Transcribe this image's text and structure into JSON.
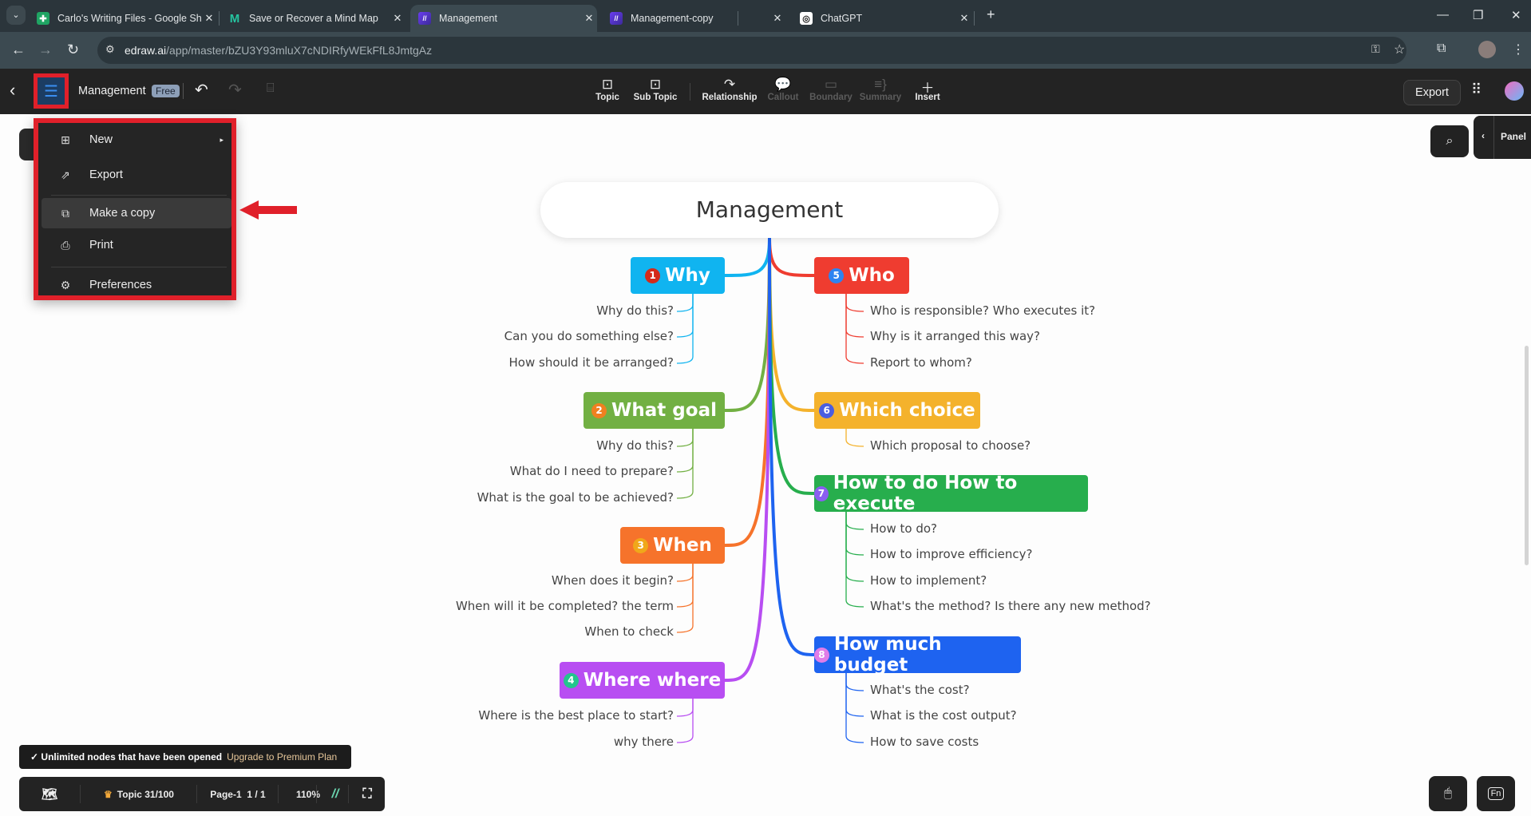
{
  "browser": {
    "tabs": [
      {
        "title": "Carlo's Writing Files - Google Sh",
        "icon": "google-sheets-icon",
        "active": false
      },
      {
        "title": "Save or Recover a Mind Map",
        "icon": "mindmap-site-icon",
        "active": false
      },
      {
        "title": "Management",
        "icon": "edraw-icon",
        "active": true
      },
      {
        "title": "Management-copy",
        "icon": "edraw-icon",
        "active": false
      },
      {
        "title": "ChatGPT",
        "icon": "chatgpt-icon",
        "active": false
      }
    ],
    "url_host": "edraw.ai",
    "url_path": "/app/master/bZU3Y93mluX7cNDIRfyWEkFfL8JmtgAz"
  },
  "app": {
    "doc_title": "Management",
    "plan_badge": "Free",
    "toolbar": [
      {
        "label": "Topic",
        "icon": "topic-icon",
        "enabled": true
      },
      {
        "label": "Sub Topic",
        "icon": "subtopic-icon",
        "enabled": true
      },
      {
        "label": "Relationship",
        "icon": "relationship-icon",
        "enabled": true
      },
      {
        "label": "Callout",
        "icon": "callout-icon",
        "enabled": false
      },
      {
        "label": "Boundary",
        "icon": "boundary-icon",
        "enabled": false
      },
      {
        "label": "Summary",
        "icon": "summary-icon",
        "enabled": false
      },
      {
        "label": "Insert",
        "icon": "plus-icon",
        "enabled": true
      }
    ],
    "export_label": "Export",
    "panel_label": "Panel"
  },
  "menu": {
    "items": [
      {
        "label": "New",
        "icon": "plus-square-icon",
        "submenu": true
      },
      {
        "label": "Export",
        "icon": "export-icon"
      },
      {
        "label": "Make a copy",
        "icon": "copy-icon",
        "highlighted": true
      },
      {
        "label": "Print",
        "icon": "printer-icon"
      },
      {
        "label": "Preferences",
        "icon": "gear-icon"
      }
    ]
  },
  "mindmap": {
    "root": "Management",
    "topics": [
      {
        "num": "1",
        "label": "Why",
        "color": "#10b4f0",
        "children": [
          "Why do this?",
          "Can you do something else?",
          "How should it be arranged?"
        ]
      },
      {
        "num": "2",
        "label": "What goal",
        "color": "#72b043",
        "children": [
          "Why do this?",
          "What do I need to prepare?",
          "What is the goal to be achieved?"
        ]
      },
      {
        "num": "3",
        "label": "When",
        "color": "#f6732b",
        "children": [
          "When does it begin?",
          "When will it be completed? the term",
          "When to check"
        ]
      },
      {
        "num": "4",
        "label": "Where where",
        "color": "#b84ef2",
        "children": [
          "Where is the best place to start?",
          "why there"
        ]
      },
      {
        "num": "5",
        "label": "Who",
        "color": "#ef3c30",
        "children": [
          "Who is responsible? Who executes it?",
          "Why is it arranged this way?",
          "Report to whom?"
        ]
      },
      {
        "num": "6",
        "label": "Which choice",
        "color": "#f4b22c",
        "children": [
          "Which proposal to choose?"
        ]
      },
      {
        "num": "7",
        "label": "How to do How to execute",
        "color": "#27ae4d",
        "children": [
          "How to do?",
          "How to improve efficiency?",
          "How to implement?",
          "What's the method? Is there any new method?"
        ]
      },
      {
        "num": "8",
        "label": "How much budget",
        "color": "#1e63f0",
        "children": [
          "What's the cost?",
          "What is the cost output?",
          "How to save costs"
        ]
      }
    ]
  },
  "status": {
    "tip_text": "Unlimited nodes that have been opened",
    "upgrade_link": "Upgrade to Premium Plan",
    "topic_count": "Topic 31/100",
    "page_name": "Page-1",
    "page_index": "1 / 1",
    "zoom": "110%"
  }
}
